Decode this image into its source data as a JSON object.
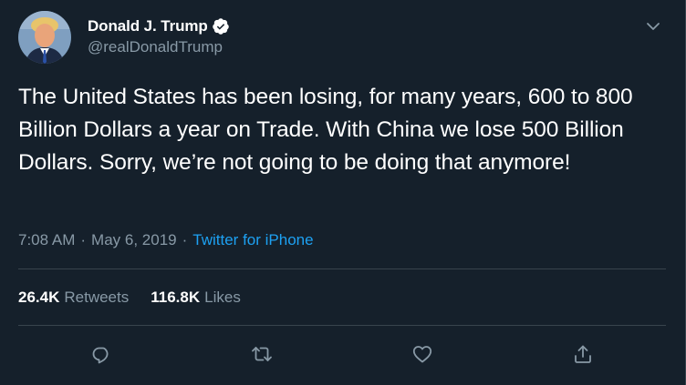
{
  "author": {
    "display_name": "Donald J. Trump",
    "handle": "@realDonaldTrump",
    "verified": true
  },
  "tweet": {
    "text": "The United States has been losing, for many years, 600 to 800 Billion Dollars a year on Trade. With China we lose 500 Billion Dollars. Sorry, we’re not going to be doing that anymore!",
    "time": "7:08 AM",
    "separator": "·",
    "date": "May 6, 2019",
    "source": "Twitter for iPhone"
  },
  "stats": {
    "retweets_count": "26.4K",
    "retweets_label": "Retweets",
    "likes_count": "116.8K",
    "likes_label": "Likes"
  },
  "actions": {
    "reply_icon": "reply-icon",
    "retweet_icon": "retweet-icon",
    "like_icon": "heart-icon",
    "share_icon": "share-icon"
  },
  "colors": {
    "background": "#15202b",
    "text": "#ffffff",
    "muted": "#8899a6",
    "accent": "#1da1f2",
    "divider": "#38444d"
  }
}
